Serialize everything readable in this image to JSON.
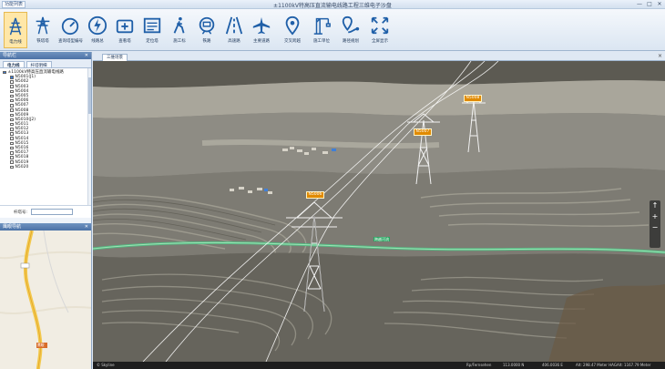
{
  "window": {
    "title": "±1100kV特高压直流输电线路工程三维电子沙盘",
    "menu_tab": "功能列表",
    "controls": [
      "—",
      "□",
      "✕"
    ]
  },
  "ribbon": {
    "tools": [
      {
        "label": "电力线",
        "icon": "pylon-icon",
        "active": true
      },
      {
        "label": "铁塔塔",
        "icon": "tower-icon",
        "active": false
      },
      {
        "label": "查询塔型编号",
        "icon": "gauge-icon",
        "active": false
      },
      {
        "label": "线路总",
        "icon": "lightning-icon",
        "active": false
      },
      {
        "label": "查看塔",
        "icon": "first-aid-icon",
        "active": false
      },
      {
        "label": "定位塔",
        "icon": "list-icon",
        "active": false
      },
      {
        "label": "施工标",
        "icon": "walker-icon",
        "active": false
      },
      {
        "label": "铁路",
        "icon": "train-icon",
        "active": false
      },
      {
        "label": "高速路",
        "icon": "highway-icon",
        "active": false
      },
      {
        "label": "主要道路",
        "icon": "plane-icon",
        "active": false
      },
      {
        "label": "交叉跨越",
        "icon": "pin-icon",
        "active": false
      },
      {
        "label": "施工单位",
        "icon": "crane-icon",
        "active": false
      },
      {
        "label": "路径规划",
        "icon": "route-pin-icon",
        "active": false
      },
      {
        "label": "全屏显示",
        "icon": "fullscreen-icon",
        "active": false
      }
    ]
  },
  "left_panel": {
    "header": "导航栏",
    "tabs": [
      "电力线",
      "杆塔明细"
    ],
    "tree_root": "±1100kV特高压直流输电线路",
    "tree_items": [
      "N5001(J1)",
      "N5002",
      "N5003",
      "N5004",
      "N5005",
      "N5006",
      "N5007",
      "N5008",
      "N5009",
      "N5010(J2)",
      "N5011",
      "N5012",
      "N5013",
      "N5014",
      "N5015",
      "N5016",
      "N5017",
      "N5018",
      "N5019",
      "N5020"
    ],
    "search_label": "杆塔号:",
    "search_value": "",
    "map_header": "鹰眼导航",
    "map_marker_label": "鹰眼"
  },
  "main": {
    "doc_tab": "三维场景",
    "close": "×",
    "tower_labels": [
      "N5008",
      "N5007",
      "N5006"
    ],
    "river_label": "跨越河流",
    "nav_controls": [
      "↑",
      "+",
      "−"
    ],
    "status": {
      "left": "© Skyline",
      "mid": "Rp/Fernsehen",
      "coords": "113.0000 N",
      "alt1": "406.0036 E",
      "alt2": "Alt: 298.47 Meter HAG",
      "alt3": "Alt: 1167.79 Meter",
      "time": "24.00 Fps"
    }
  }
}
